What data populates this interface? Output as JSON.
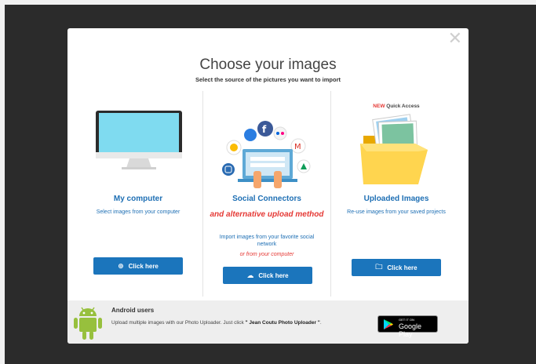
{
  "modal": {
    "close_glyph": "✕",
    "title": "Choose your images",
    "subtitle": "Select the source of the pictures you want to import"
  },
  "columns": [
    {
      "title": "My computer",
      "description": "Select images from your computer",
      "button_label": "Click here",
      "button_icon": "plus-circle-icon"
    },
    {
      "title": "Social Connectors",
      "alt_text": "and alternative upload method",
      "description": "Import images from your favorite social network",
      "alt_note": "or from your computer",
      "button_label": "Click here",
      "button_icon": "cloud-upload-icon"
    },
    {
      "badge_new": "NEW",
      "badge_label": "Quick Access",
      "title": "Uploaded Images",
      "description": "Re-use images from your saved projects",
      "button_label": "Click here",
      "button_icon": "folder-icon"
    }
  ],
  "footer": {
    "title": "Android users",
    "text_pre": "Upload multiple images with our Photo Uploader. Just click ",
    "text_bold": "\" Jean Coutu Photo Uploader \"",
    "text_post": ".",
    "store_small": "GET IT ON",
    "store_big": "Google Play"
  },
  "colors": {
    "accent": "#1b75bc",
    "link": "#1e6fb4",
    "alert": "#e53935",
    "overlay": "#2b2b2b"
  }
}
